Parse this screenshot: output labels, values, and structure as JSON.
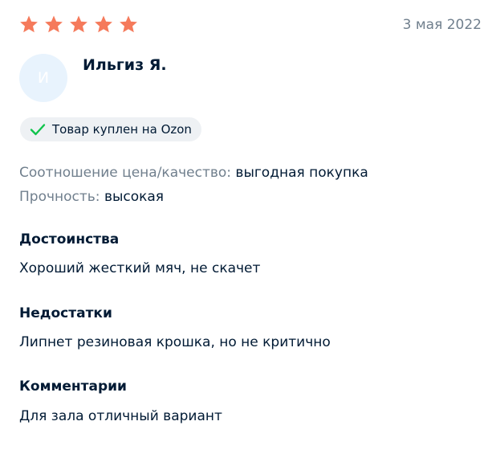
{
  "review": {
    "rating": 5,
    "rating_max": 5,
    "star_color": "#f57a5b",
    "date": "3 мая 2022",
    "author": {
      "name": "Ильгиз Я.",
      "avatar_letter": "И"
    },
    "badge": {
      "icon": "check-icon",
      "label": "Товар куплен на Ozon"
    },
    "properties": [
      {
        "label": "Соотношение цена/качество:",
        "value": "выгодная покупка"
      },
      {
        "label": "Прочность:",
        "value": "высокая"
      }
    ],
    "sections": [
      {
        "title": "Достоинства",
        "text": "Хороший жесткий мяч, не скачет"
      },
      {
        "title": "Недостатки",
        "text": "Липнет резиновая крошка, но не критично"
      },
      {
        "title": "Комментарии",
        "text": "Для зала отличный вариант"
      }
    ]
  }
}
